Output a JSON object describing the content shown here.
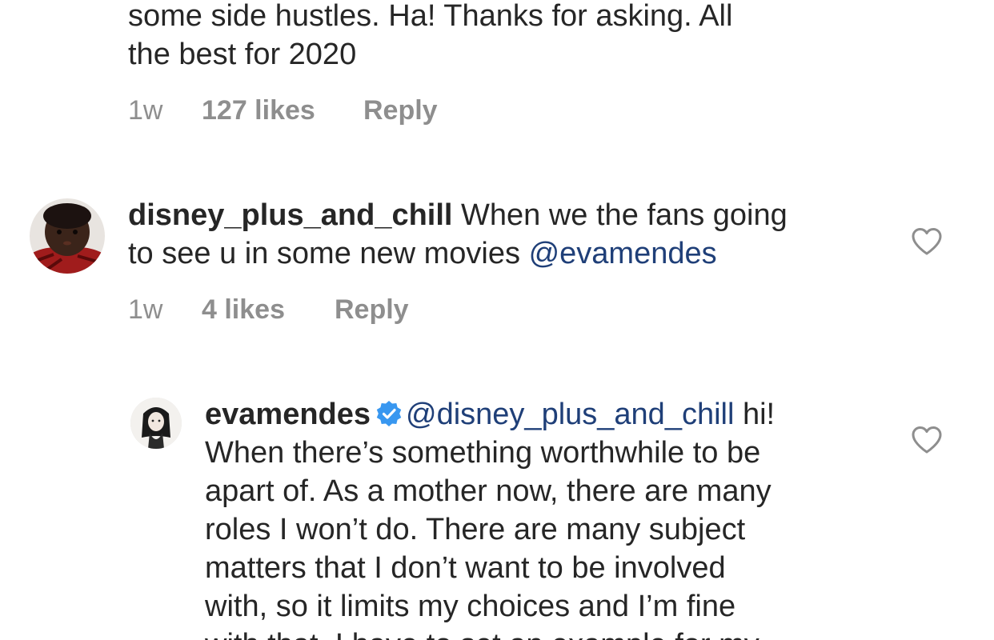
{
  "comment_top": {
    "text_lines": [
      "some side hustles. Ha! Thanks for asking. All",
      "the best for 2020"
    ],
    "time": "1w",
    "likes": "127 likes",
    "reply": "Reply"
  },
  "comment_fan": {
    "username": "disney_plus_and_chill",
    "text_line1": " When we the fans going",
    "text_line2": "to see u in some new movies ",
    "mention": "@evamendes",
    "time": "1w",
    "likes": "4 likes",
    "reply": "Reply",
    "avatar_icon": "baby-avatar-icon",
    "like_icon": "heart-outline-icon"
  },
  "comment_reply": {
    "username": "evamendes",
    "verified_icon": "verified-badge-icon",
    "verified_color": "#3897f0",
    "mention": "@disney_plus_and_chill",
    "text_line1_tail": " hi!",
    "text_lines": [
      "When there’s something worthwhile to be",
      "apart of. As a mother now, there are many",
      "roles I won’t do. There are many subject",
      "matters that I don’t want to be involved",
      "with,  so it limits my choices and I’m fine",
      "with that. I have to set an example for my"
    ],
    "avatar_icon": "eva-avatar-icon",
    "like_icon": "heart-outline-icon"
  },
  "colors": {
    "text": "#262626",
    "meta": "#8e8e8e",
    "mention": "#1f3f78",
    "background": "#ffffff"
  }
}
